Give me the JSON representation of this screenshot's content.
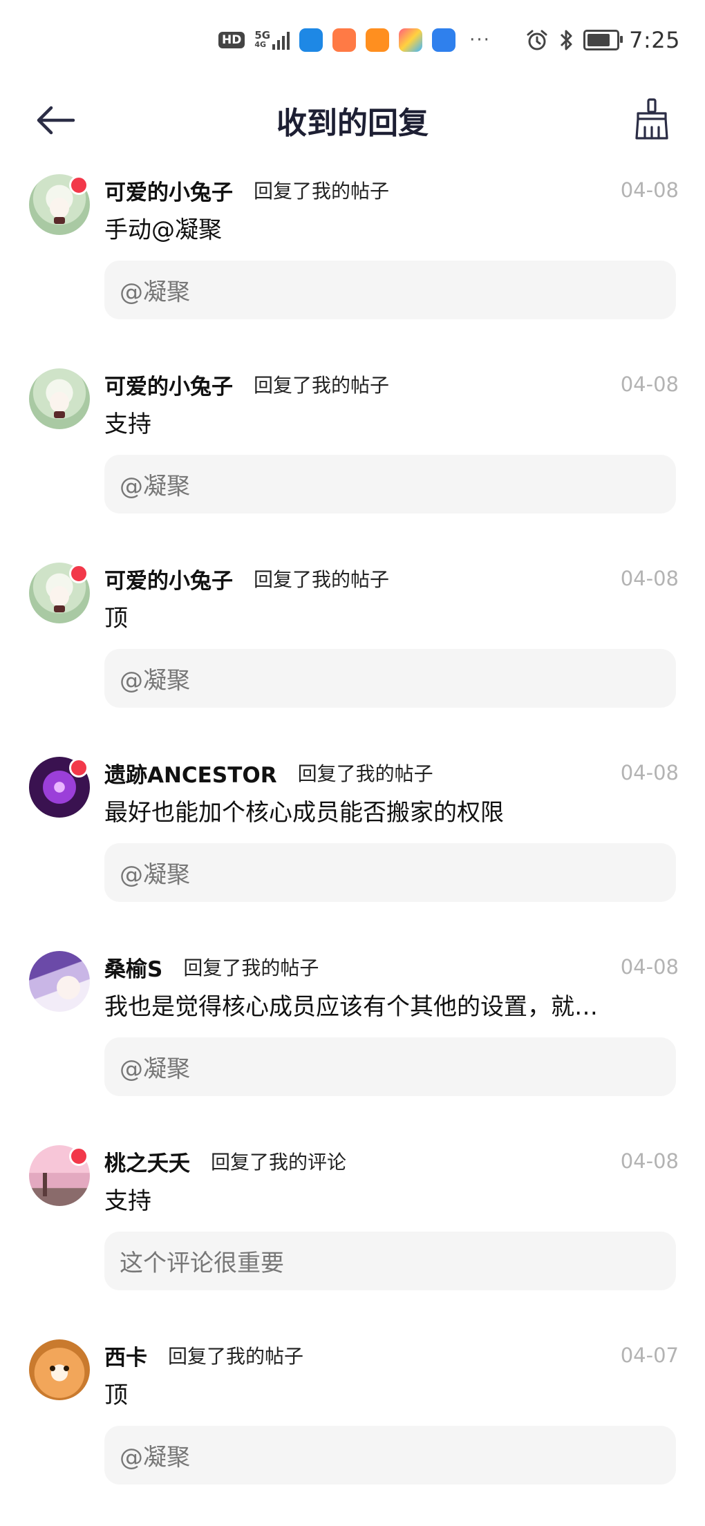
{
  "status_bar": {
    "hd_label": "HD",
    "network_label": "5G",
    "network_sublabel": "4G",
    "more": "···",
    "time": "7:25"
  },
  "header": {
    "title": "收到的回复",
    "back_icon": "arrow-left-icon",
    "clear_icon": "broom-icon"
  },
  "colors": {
    "title": "#1d1f33",
    "unread": "#f2384a",
    "date": "#b3b3b3",
    "quote_bg": "#f5f5f5"
  },
  "replies": [
    {
      "user": "可爱的小兔子",
      "action": "回复了我的帖子",
      "date": "04-08",
      "content": "手动@凝聚",
      "quote": "@凝聚",
      "unread": true
    },
    {
      "user": "可爱的小兔子",
      "action": "回复了我的帖子",
      "date": "04-08",
      "content": "支持",
      "quote": "@凝聚",
      "unread": false
    },
    {
      "user": "可爱的小兔子",
      "action": "回复了我的帖子",
      "date": "04-08",
      "content": "顶",
      "quote": "@凝聚",
      "unread": true
    },
    {
      "user": "遗跡ANCESTOR",
      "action": "回复了我的帖子",
      "date": "04-08",
      "content": "最好也能加个核心成员能否搬家的权限",
      "quote": "@凝聚",
      "unread": true
    },
    {
      "user": "桑榆S",
      "action": "回复了我的帖子",
      "date": "04-08",
      "content": "我也是觉得核心成员应该有个其他的设置，就…",
      "quote": "@凝聚",
      "unread": false
    },
    {
      "user": "桃之夭夭",
      "action": "回复了我的评论",
      "date": "04-08",
      "content": "支持",
      "quote": "这个评论很重要",
      "unread": true
    },
    {
      "user": "西卡",
      "action": "回复了我的帖子",
      "date": "04-07",
      "content": "顶",
      "quote": "@凝聚",
      "unread": false
    }
  ]
}
